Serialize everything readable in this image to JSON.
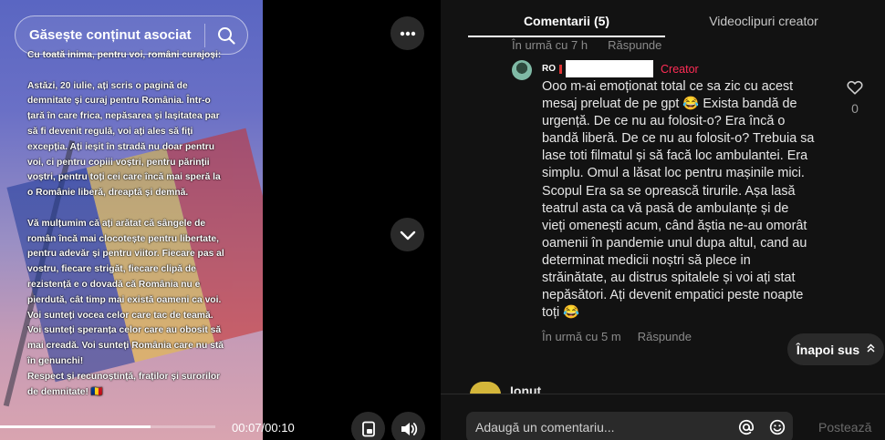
{
  "video": {
    "search_label": "Găsește conținut asociat",
    "caption_lines": [
      "Cu toată inima, pentru voi, români curajoși:",
      "",
      "Astăzi, 20 iulie, ați scris o pagină de",
      "demnitate și curaj pentru România. Într-o",
      "țară în care frica, nepăsarea și lașitatea par",
      "să fi devenit regulă, voi ați ales să fiți",
      "excepția. Ați ieșit în stradă nu doar pentru",
      "voi, ci pentru copiii voștri, pentru părinții",
      "voștri, pentru toți cei care încă mai speră la",
      "o Românie liberă, dreaptă și demnă.",
      "",
      "Vă mulțumim că ați arătat că sângele de",
      "român încă mai clocotește pentru libertate,",
      "pentru adevăr și pentru viitor. Fiecare pas al",
      "vostru, fiecare strigăt, fiecare clipă de",
      "rezistență e o dovadă că România nu e",
      "pierdută, cât timp mai există oameni ca voi.",
      "Voi sunteți vocea celor care tac de teamă.",
      "Voi sunteți speranța celor care au obosit să",
      "mai creadă. Voi sunteți România care nu stă",
      "în genunchi!",
      "Respect și recunoștință, fraților și surorilor",
      "de demnitate! 🇷🇴"
    ],
    "progress_fraction": 0.7,
    "time_display": "00:07/00:10"
  },
  "panel": {
    "tabs": [
      {
        "label": "Comentarii (5)",
        "active": true
      },
      {
        "label": "Videoclipuri creator",
        "active": false
      }
    ],
    "prev_comment_meta": {
      "time": "În urmă cu 7 h",
      "reply": "Răspunde"
    },
    "comment": {
      "author_prefix": "RO",
      "creator_badge": "Creator",
      "text_lines": [
        "Ooo m-ai emoționat total ce sa zic cu acest",
        "mesaj preluat de pe gpt 😂 Exista bandă de",
        "urgență. De ce nu au folosit-o? Era încă o",
        "bandă liberă. De ce nu au folosit-o? Trebuia sa",
        "lase toti filmatul și să facă loc ambulantei. Era",
        "simplu. Omul a lăsat loc pentru mașinile mici.",
        "Scopul Era sa se oprească tirurile. Așa lasă",
        "teatrul asta ca vă pasă de ambulanțe și de",
        "vieți omenești acum, când ăștia ne-au omorât",
        "oamenii în pandemie unul dupa altul, cand au",
        "determinat medicii noștri să plece in",
        "străinătate, au distrus spitalele și voi ați stat",
        "nepăsători. Ați devenit empatici peste noapte",
        "toți 😂"
      ],
      "like_count": "0",
      "time": "În urmă cu 5 m",
      "reply": "Răspunde"
    },
    "back_to_top": "Înapoi sus",
    "next_comment_author": "Ionut",
    "input": {
      "placeholder": "Adaugă un comentariu..."
    },
    "post_label": "Postează"
  }
}
